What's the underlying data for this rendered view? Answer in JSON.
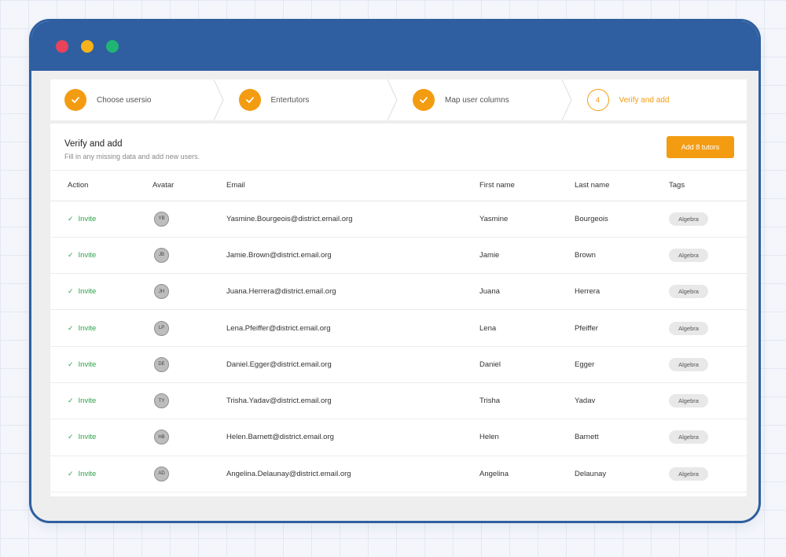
{
  "window": {
    "titlebar_color": "#2f5fa0",
    "accent_color": "#f39c12",
    "success_color": "#2fa24a"
  },
  "stepper": {
    "steps": [
      {
        "label": "Choose usersio",
        "state": "done",
        "number": ""
      },
      {
        "label": "Entertutors",
        "state": "done",
        "number": ""
      },
      {
        "label": "Map user columns",
        "state": "done",
        "number": ""
      },
      {
        "label": "Verify and add",
        "state": "active",
        "number": "4"
      }
    ]
  },
  "panel": {
    "title": "Verify and add",
    "subtitle": "Fill in any missing data and add new users.",
    "add_button_label": "Add 8 tutors"
  },
  "table": {
    "columns": [
      "Action",
      "Avatar",
      "Email",
      "First name",
      "Last name",
      "Tags"
    ],
    "rows": [
      {
        "action": "Invite",
        "initials": "YB",
        "email": "Yasmine.Bourgeois@district.email.org",
        "first": "Yasmine",
        "last": "Bourgeois",
        "tag": "Algebra"
      },
      {
        "action": "Invite",
        "initials": "JB",
        "email": "Jamie.Brown@district.email.org",
        "first": "Jamie",
        "last": "Brown",
        "tag": "Algebra"
      },
      {
        "action": "Invite",
        "initials": "JH",
        "email": "Juana.Herrera@district.email.org",
        "first": "Juana",
        "last": "Herrera",
        "tag": "Algebra"
      },
      {
        "action": "Invite",
        "initials": "LP",
        "email": "Lena.Pfeiffer@district.email.org",
        "first": "Lena",
        "last": "Pfeiffer",
        "tag": "Algebra"
      },
      {
        "action": "Invite",
        "initials": "DE",
        "email": "Daniel.Egger@district.email.org",
        "first": "Daniel",
        "last": "Egger",
        "tag": "Algebra"
      },
      {
        "action": "Invite",
        "initials": "TY",
        "email": "Trisha.Yadav@district.email.org",
        "first": "Trisha",
        "last": "Yadav",
        "tag": "Algebra"
      },
      {
        "action": "Invite",
        "initials": "HB",
        "email": "Helen.Barnett@district.email.org",
        "first": "Helen",
        "last": "Barnett",
        "tag": "Algebra"
      },
      {
        "action": "Invite",
        "initials": "AD",
        "email": "Angelina.Delaunay@district.email.org",
        "first": "Angelina",
        "last": "Delaunay",
        "tag": "Algebra"
      }
    ]
  }
}
